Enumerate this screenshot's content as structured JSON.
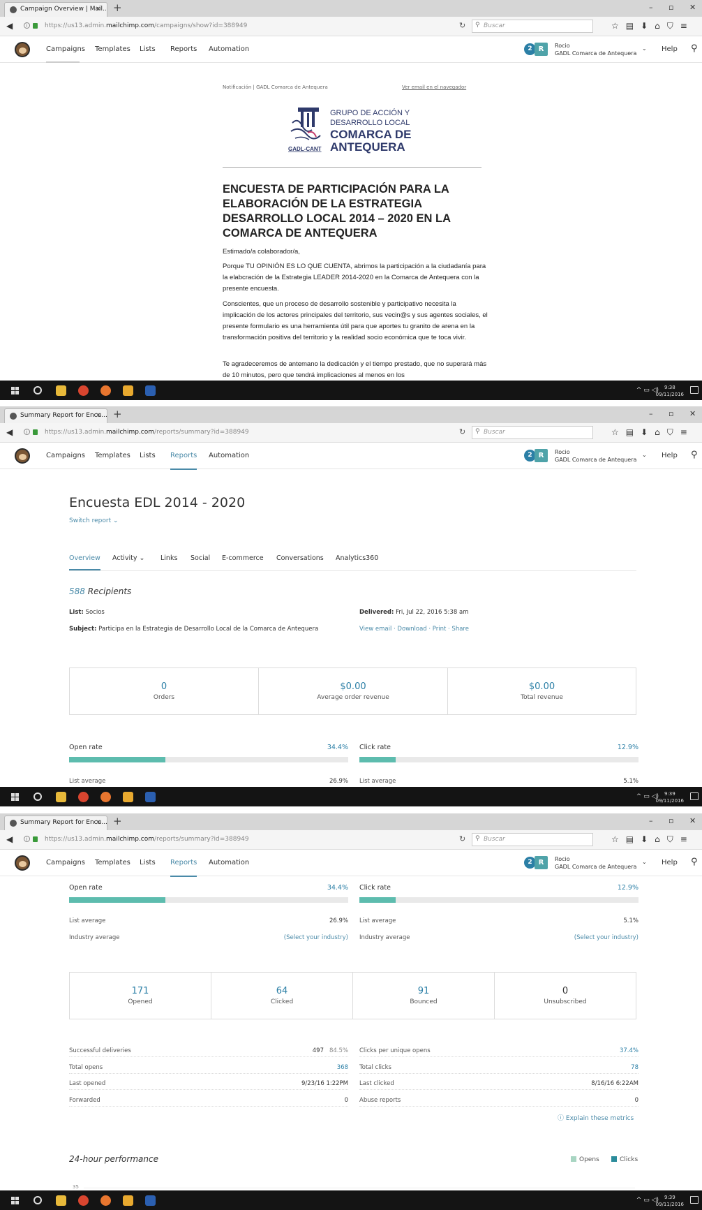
{
  "browser": {
    "search_placeholder": "Buscar",
    "tab1_title": "Campaign Overview | Mail...",
    "tab2_title": "Summary Report for Encu...",
    "tab3_title": "Summary Report for Encu...",
    "url1_pre": "https://us13.admin.",
    "url1_domain": "mailchimp.com",
    "url1_post": "/campaigns/show?id=388949",
    "url2_pre": "https://us13.admin.",
    "url2_domain": "mailchimp.com",
    "url2_post": "/reports/summary?id=388949",
    "url3_pre": "https://us13.admin.",
    "url3_domain": "mailchimp.com",
    "url3_post": "/reports/summary?id=388949"
  },
  "nav": {
    "items": [
      "Campaigns",
      "Templates",
      "Lists",
      "Reports",
      "Automation"
    ],
    "badge": "2",
    "avatar": "R",
    "user_name": "Rocio",
    "user_org": "GADL Comarca de Antequera",
    "help": "Help"
  },
  "email": {
    "top_left": "Notificación | GADL Comarca de Antequera",
    "top_right": "Ver email en el navegador",
    "logo_line1": "GRUPO DE ACCIÓN Y",
    "logo_line2": "DESARROLLO LOCAL",
    "logo_line3": "COMARCA DE",
    "logo_line4": "ANTEQUERA",
    "logo_tag": "GADL-CANT",
    "title": "ENCUESTA DE PARTICIPACIÓN PARA LA ELABORACIÓN DE LA ESTRATEGIA DESARROLLO LOCAL 2014 – 2020 EN LA COMARCA DE ANTEQUERA",
    "greeting": "Estimado/a colaborador/a,",
    "p1": "Porque TU OPINIÓN ES LO QUE CUENTA, abrimos la participación a la ciudadanía para la elabcración de la Estrategia LEADER 2014-2020 en la Comarca de Antequera con la presente encuesta.",
    "p2": "Conscientes, que un proceso de desarrollo sostenible y participativo necesita la implicación de los actores principales del territorio, sus vecin@s y sus agentes sociales, el presente formulario es una herramienta útil para que aportes tu granito de arena en la transformación positiva del territorio y la realidad socio económica que te toca vivir.",
    "p3": "Te agradeceremos de antemano la dedicación y el tiempo prestado, que no superará más de 10 minutos, pero que tendrá implicaciones al menos en los"
  },
  "taskbar": {
    "time1": "9:38",
    "date1": "09/11/2016",
    "time2": "9:39",
    "date2": "09/11/2016",
    "time3": "9:39",
    "date3": "09/11/2016"
  },
  "report": {
    "title": "Encuesta EDL 2014 - 2020",
    "switch": "Switch report",
    "tabs": [
      "Overview",
      "Activity",
      "Links",
      "Social",
      "E-commerce",
      "Conversations",
      "Analytics360"
    ],
    "recipients_count": "588",
    "recipients_label": "Recipients",
    "list_label": "List:",
    "list_value": "Socios",
    "subject_label": "Subject:",
    "subject_value": "Participa en la Estrategia de Desarrollo Local de la Comarca de Antequera",
    "delivered_label": "Delivered:",
    "delivered_value": "Fri, Jul 22, 2016 5:38 am",
    "links": "View email · Download · Print · Share",
    "ecommerce": [
      {
        "value": "0",
        "label": "Orders"
      },
      {
        "value": "$0.00",
        "label": "Average order revenue"
      },
      {
        "value": "$0.00",
        "label": "Total revenue"
      }
    ],
    "open_rate": {
      "label": "Open rate",
      "value": "34.4%",
      "fill": 0.344
    },
    "click_rate": {
      "label": "Click rate",
      "value": "12.9%",
      "fill": 0.129
    },
    "list_average_label": "List average",
    "open_list_avg": "26.9%",
    "click_list_avg": "5.1%",
    "industry_average_label": "Industry average",
    "select_industry": "(Select your industry)",
    "counts": [
      {
        "value": "171",
        "label": "Opened"
      },
      {
        "value": "64",
        "label": "Clicked"
      },
      {
        "value": "91",
        "label": "Bounced"
      },
      {
        "value": "0",
        "label": "Unsubscribed"
      }
    ],
    "stats_left": [
      {
        "label": "Successful deliveries",
        "value": "497",
        "pct": "84.5%"
      },
      {
        "label": "Total opens",
        "value": "368"
      },
      {
        "label": "Last opened",
        "value": "9/23/16 1:22PM"
      },
      {
        "label": "Forwarded",
        "value": "0"
      }
    ],
    "stats_right": [
      {
        "label": "Clicks per unique opens",
        "value": "37.4%"
      },
      {
        "label": "Total clicks",
        "value": "78"
      },
      {
        "label": "Last clicked",
        "value": "8/16/16 6:22AM"
      },
      {
        "label": "Abuse reports",
        "value": "0"
      }
    ],
    "explain": "Explain these metrics",
    "perf_title": "24-hour performance",
    "legend_opens": "Opens",
    "legend_clicks": "Clicks",
    "tick_top": "35"
  },
  "colors": {
    "accent": "#4a8aa8",
    "bar_fill": "#5dbcae",
    "opens": "#a8d5c2",
    "clicks": "#2b8c9b"
  }
}
